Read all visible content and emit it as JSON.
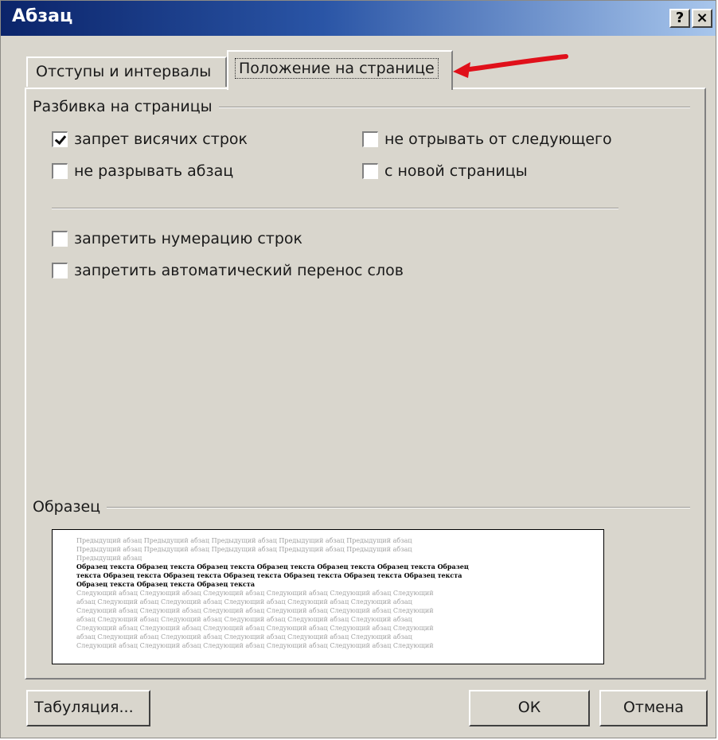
{
  "window": {
    "title": "Абзац",
    "help_label": "?",
    "close_label": "×"
  },
  "tabs": [
    {
      "label": "Отступы и интервалы",
      "active": false
    },
    {
      "label": "Положение на странице",
      "active": true
    }
  ],
  "pagination": {
    "group_label": "Разбивка на страницы",
    "options": [
      {
        "label": "запрет висячих строк",
        "checked": true
      },
      {
        "label": "не отрывать от следующего",
        "checked": false
      },
      {
        "label": "не разрывать абзац",
        "checked": false
      },
      {
        "label": "с новой страницы",
        "checked": false
      }
    ]
  },
  "extra_options": [
    {
      "label": "запретить нумерацию строк",
      "checked": false
    },
    {
      "label": "запретить автоматический перенос слов",
      "checked": false
    }
  ],
  "preview": {
    "group_label": "Образец",
    "prev_lines": [
      "Предыдущий абзац Предыдущий абзац Предыдущий абзац Предыдущий абзац Предыдущий абзац",
      "Предыдущий абзац Предыдущий абзац Предыдущий абзац Предыдущий абзац Предыдущий абзац",
      "Предыдущий абзац"
    ],
    "sample_lines": [
      "Образец текста Образец текста Образец текста Образец текста Образец текста Образец текста Образец",
      "текста Образец текста Образец текста Образец текста Образец текста Образец текста Образец текста",
      "Образец текста Образец текста Образец текста"
    ],
    "next_lines": [
      "Следующий абзац Следующий абзац Следующий абзац Следующий абзац Следующий абзац Следующий",
      "абзац Следующий абзац Следующий абзац Следующий абзац Следующий абзац Следующий абзац",
      "Следующий абзац Следующий абзац Следующий абзац Следующий абзац Следующий абзац Следующий",
      "абзац Следующий абзац Следующий абзац Следующий абзац Следующий абзац Следующий абзац",
      "Следующий абзац Следующий абзац Следующий абзац Следующий абзац Следующий абзац Следующий",
      "абзац Следующий абзац Следующий абзац Следующий абзац Следующий абзац Следующий абзац",
      "Следующий абзац Следующий абзац Следующий абзац Следующий абзац Следующий абзац Следующий"
    ]
  },
  "buttons": {
    "tabulation": "Табуляция...",
    "ok": "ОК",
    "cancel": "Отмена"
  },
  "annotation_color": "#e0101a"
}
